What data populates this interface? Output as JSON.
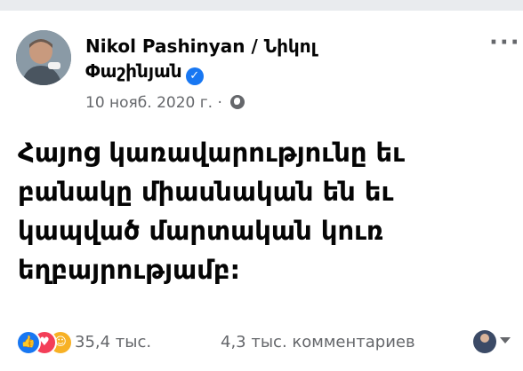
{
  "post": {
    "author_line1": "Nikol Pashinyan / Նիկոլ",
    "author_line2": "Փաշինյան",
    "verified_mark": "✓",
    "date": "10 нояб. 2020 г. ·",
    "audience_icon": "globe-icon",
    "more_icon": "ellipsis-icon",
    "text_lines": [
      "Հայոց կառավարությունը եւ",
      "բանակը միասնական են եւ",
      "կապված մարտական կուռ",
      "եղբայրությամբ:"
    ]
  },
  "engagement": {
    "reaction_icons": [
      "like-icon",
      "love-icon",
      "care-icon"
    ],
    "reactions_count": "35,4 тыс.",
    "comments_count": "4,3 тыс. комментариев"
  },
  "colors": {
    "accent": "#1877f2",
    "text_primary": "#050505",
    "text_secondary": "#65676b",
    "love": "#f33e58",
    "care": "#f7b125"
  }
}
